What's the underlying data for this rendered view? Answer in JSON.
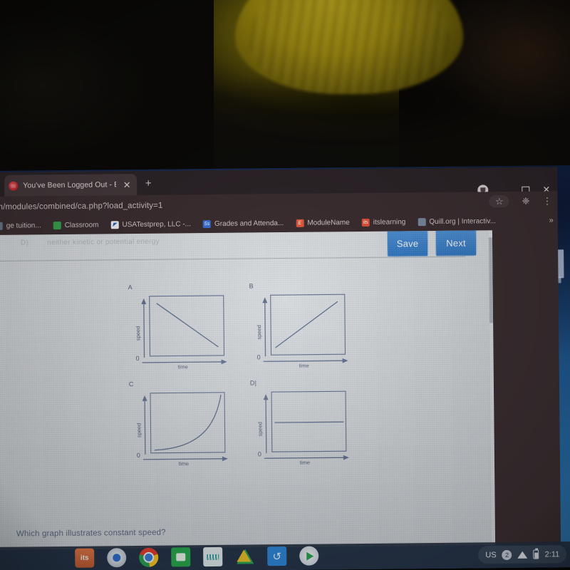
{
  "browser": {
    "tab": {
      "title": "You've Been Logged Out - Brain",
      "favicon_name": "brainly-favicon",
      "close_label": "✕",
      "new_tab_label": "+"
    },
    "url": "m/modules/combined/ca.php?load_activity=1",
    "omnibox_icons": {
      "bookmark_star": "☆",
      "extensions": "❈",
      "menu": "⋮"
    },
    "window_controls": {
      "minimize": "—",
      "maximize": "❐",
      "close": "✕"
    },
    "bookmarks": [
      {
        "label": "ge tuition...",
        "icon_text": "",
        "icon_color": "#6d7a8c"
      },
      {
        "label": "Classroom",
        "icon_text": "▣",
        "icon_color": "#3aa34f"
      },
      {
        "label": "USATestprep, LLC -...",
        "icon_text": "◤",
        "icon_color": "#ffffff"
      },
      {
        "label": "Grades and Attenda...",
        "icon_text": "5s",
        "icon_color": "#3b6fd4"
      },
      {
        "label": "ModuleName",
        "icon_text": "E",
        "icon_color": "#e05a3c"
      },
      {
        "label": "itslearning",
        "icon_text": "its",
        "icon_color": "#e0513a"
      },
      {
        "label": "Quill.org | Interactiv...",
        "icon_text": "Q",
        "icon_color": "#7b8aa0"
      }
    ],
    "bookmarks_overflow": "»"
  },
  "page": {
    "faded_previous_line": {
      "lead": "D)",
      "text": "neither kinetic or potential energy"
    },
    "buttons": {
      "save": "Save",
      "next": "Next"
    },
    "question": "Which graph illustrates constant speed?",
    "graphs": [
      {
        "key": "A",
        "label": "A",
        "shape": "linear-decreasing",
        "x_axis": "time",
        "y_axis": "speed",
        "origin": "0"
      },
      {
        "key": "B",
        "label": "B",
        "shape": "linear-increasing",
        "x_axis": "time",
        "y_axis": "speed",
        "origin": "0"
      },
      {
        "key": "C",
        "label": "C",
        "shape": "exponential-increasing",
        "x_axis": "time",
        "y_axis": "speed",
        "origin": "0"
      },
      {
        "key": "D",
        "label": "D|",
        "shape": "constant-horizontal",
        "x_axis": "time",
        "y_axis": "speed",
        "origin": "0"
      }
    ]
  },
  "chart_data": {
    "type": "line",
    "title": "Which graph illustrates constant speed?",
    "xlabel": "time",
    "ylabel": "speed",
    "panels": [
      {
        "label": "A",
        "description": "Speed decreases linearly with time",
        "x": [
          0.08,
          1.0
        ],
        "y": [
          0.93,
          0.18
        ],
        "curve": "linear"
      },
      {
        "label": "B",
        "description": "Speed increases linearly with time",
        "x": [
          0.06,
          0.95
        ],
        "y": [
          0.12,
          0.9
        ],
        "curve": "linear"
      },
      {
        "label": "C",
        "description": "Speed increases exponentially with time",
        "x": [
          0.05,
          0.25,
          0.5,
          0.72,
          0.88,
          0.97
        ],
        "y": [
          0.05,
          0.08,
          0.16,
          0.32,
          0.6,
          0.98
        ],
        "curve": "exponential"
      },
      {
        "label": "D",
        "description": "Speed remains constant over time (horizontal line)",
        "x": [
          0.05,
          0.98
        ],
        "y": [
          0.5,
          0.5
        ],
        "curve": "constant"
      }
    ],
    "grid": false,
    "legend": "none",
    "answer_shape": "constant-horizontal"
  },
  "shelf": {
    "apps": [
      {
        "name": "itslearning",
        "short": "its"
      },
      {
        "name": "camera",
        "short": ""
      },
      {
        "name": "chrome",
        "short": ""
      },
      {
        "name": "classroom",
        "short": ""
      },
      {
        "name": "teal-app",
        "short": ""
      },
      {
        "name": "google-drive",
        "short": ""
      },
      {
        "name": "blue-refresh-app",
        "short": ""
      },
      {
        "name": "play-store",
        "short": ""
      }
    ],
    "tray": {
      "locale": "US",
      "notification_count": "2",
      "time": "2:11"
    }
  },
  "colors": {
    "button_blue": "#2f78c6",
    "graph_ink": "#5a6c8c",
    "page_bg": "#d8dde2",
    "browser_chrome": "#3b2e31",
    "wallpaper": "#1f5c96"
  }
}
